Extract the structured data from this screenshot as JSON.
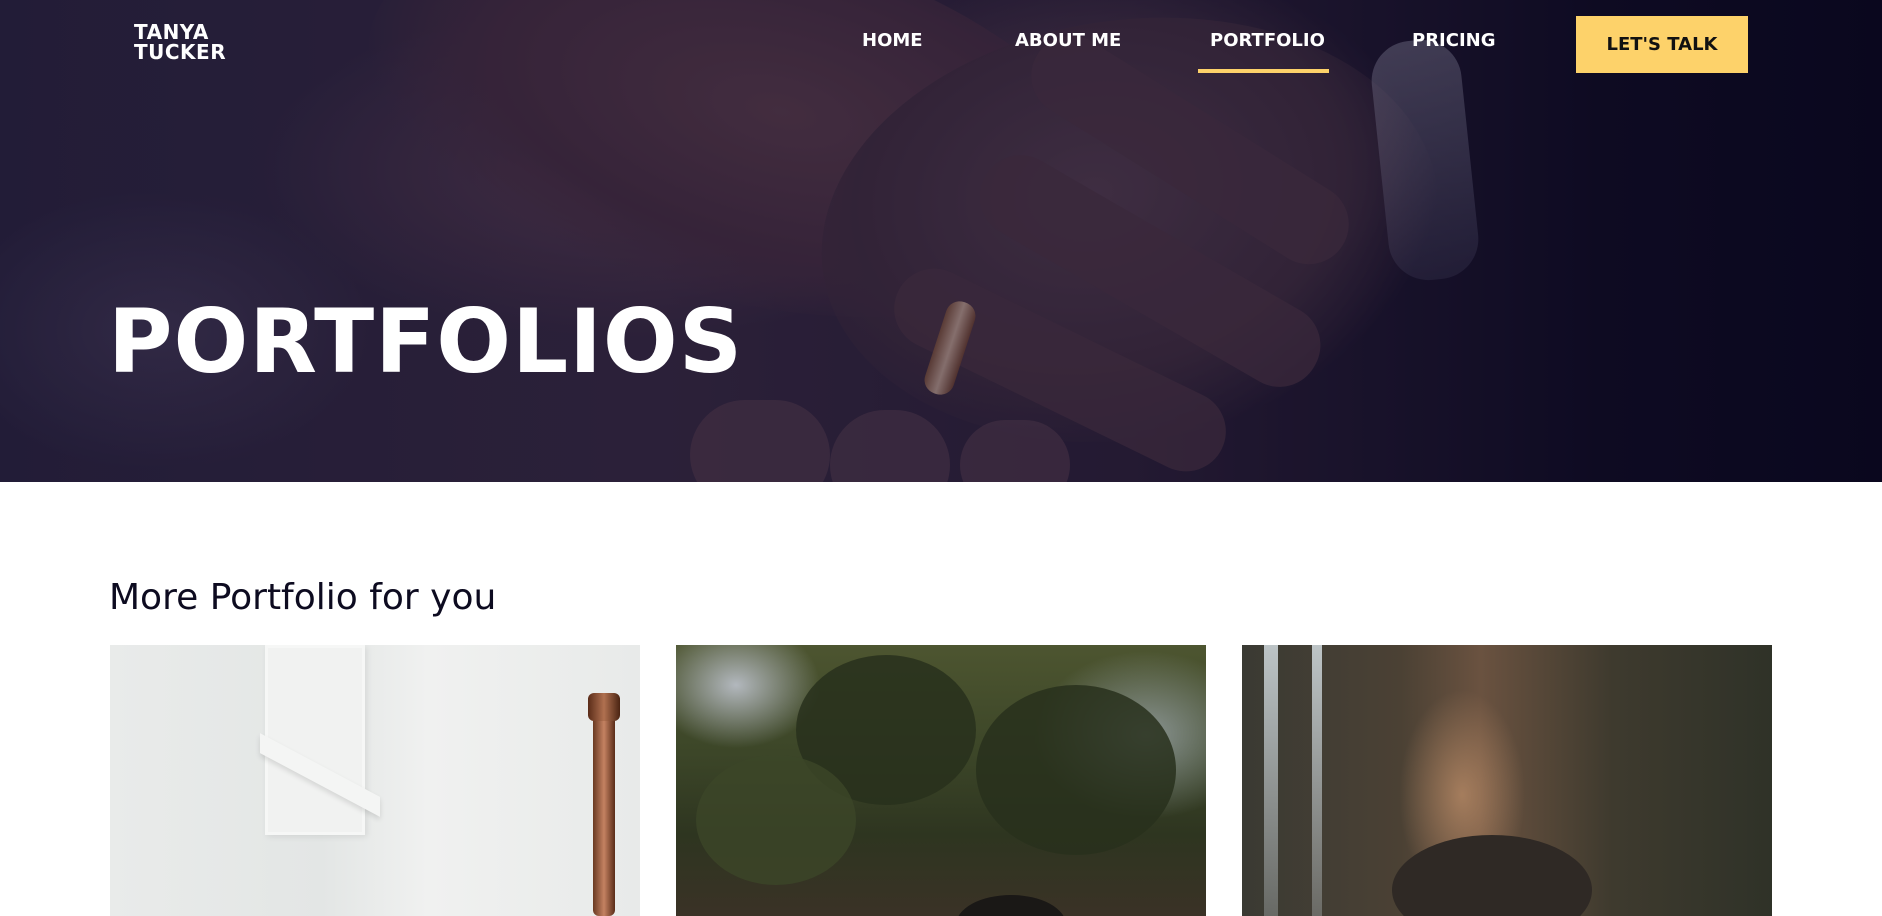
{
  "brand": {
    "line1": "TANYA",
    "line2": "TUCKER"
  },
  "nav": {
    "items": [
      {
        "label": "HOME",
        "active": false
      },
      {
        "label": "ABOUT ME",
        "active": false
      },
      {
        "label": "PORTFOLIO",
        "active": true
      },
      {
        "label": "PRICING",
        "active": false
      }
    ],
    "cta_label": "LET'S TALK"
  },
  "hero": {
    "title": "PORTFOLIOS"
  },
  "section": {
    "title": "More Portfolio for you"
  },
  "colors": {
    "accent": "#fdd26a",
    "hero_dark": "#0d0b20",
    "text_dark": "#0d0b20"
  }
}
